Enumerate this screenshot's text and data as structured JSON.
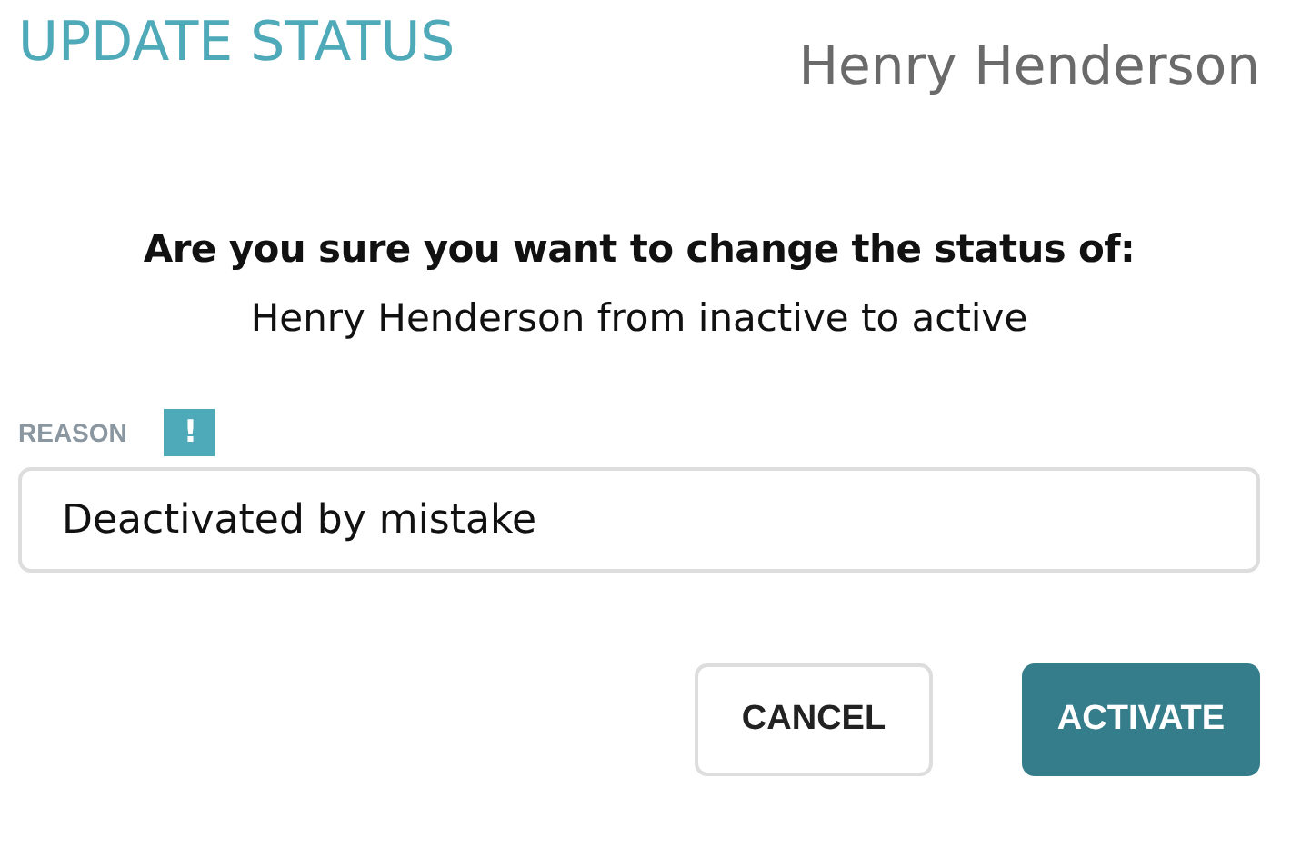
{
  "header": {
    "title": "UPDATE STATUS",
    "person": "Henry Henderson"
  },
  "confirm": {
    "question": "Are you sure you want to change the status of:",
    "detail": "Henry Henderson from inactive to active"
  },
  "reason": {
    "label": "REASON",
    "marker": "!",
    "value": "Deactivated by mistake"
  },
  "buttons": [
    {
      "label": "CANCEL",
      "kind": "secondary"
    },
    {
      "label": "ACTIVATE",
      "kind": "primary"
    }
  ]
}
